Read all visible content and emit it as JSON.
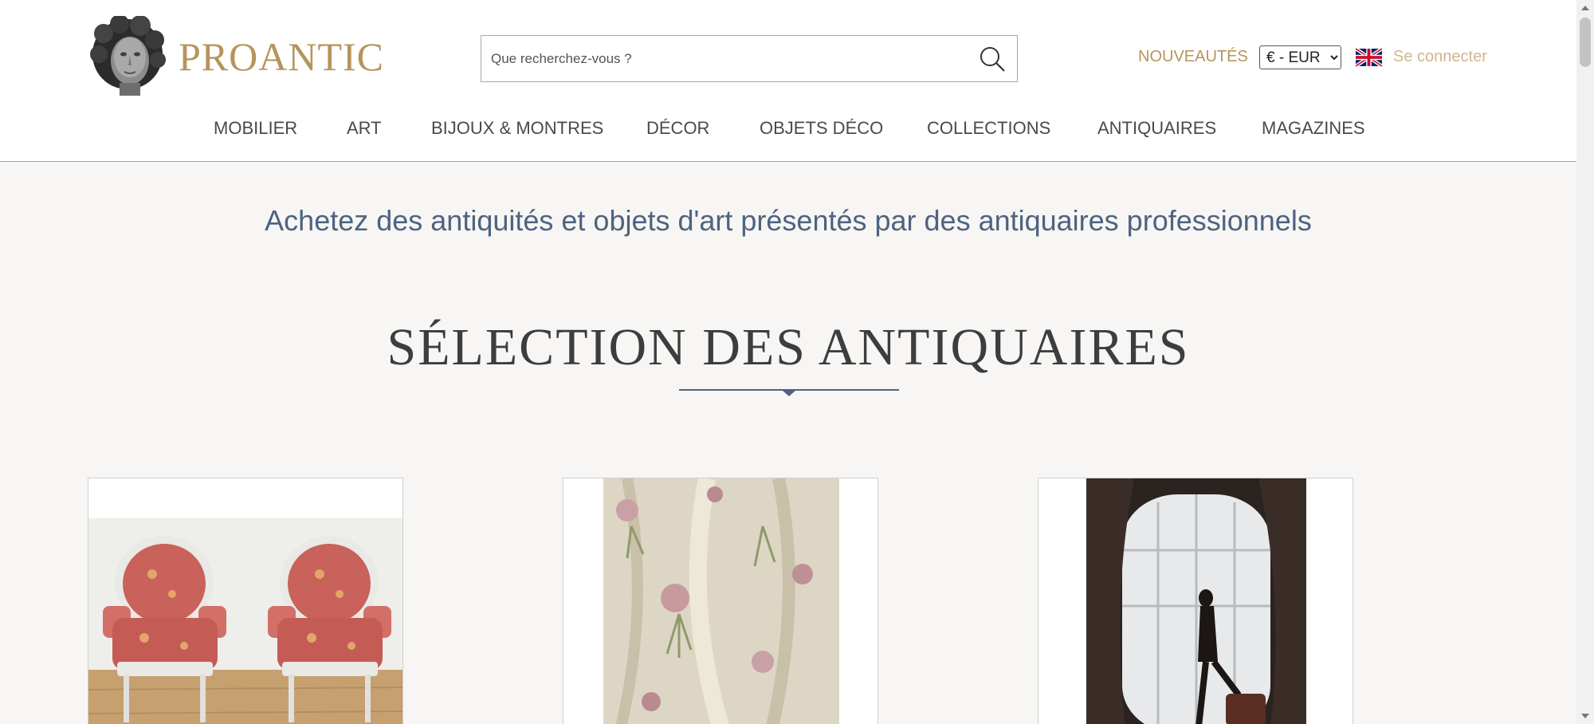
{
  "header": {
    "brand": "PROANTIC",
    "search": {
      "placeholder": "Que recherchez-vous ?",
      "value": ""
    },
    "nouveautes_label": "NOUVEAUTÉS",
    "currency": {
      "selected": "€ - EUR"
    },
    "language_icon": "uk-flag-icon",
    "login_label": "Se connecter"
  },
  "nav": {
    "items": [
      {
        "label": "MOBILIER"
      },
      {
        "label": "ART"
      },
      {
        "label": "BIJOUX & MONTRES"
      },
      {
        "label": "DÉCOR"
      },
      {
        "label": "OBJETS DÉCO"
      },
      {
        "label": "COLLECTIONS"
      },
      {
        "label": "ANTIQUAIRES"
      },
      {
        "label": "MAGAZINES"
      }
    ]
  },
  "main": {
    "tagline": "Achetez des antiquités et objets d'art présentés par des antiquaires professionnels",
    "section_title": "SÉLECTION DES ANTIQUAIRES",
    "products": [
      {
        "image": "pair-of-red-floral-armchairs"
      },
      {
        "image": "floral-brocade-fabric"
      },
      {
        "image": "photograph-woman-at-window"
      }
    ]
  },
  "colors": {
    "brand_gold": "#b6945a",
    "login_gold": "#cdb68d",
    "tagline_blue": "#4d6380",
    "nav_text": "#4a4a4a",
    "page_background": "#f7f6f4"
  }
}
